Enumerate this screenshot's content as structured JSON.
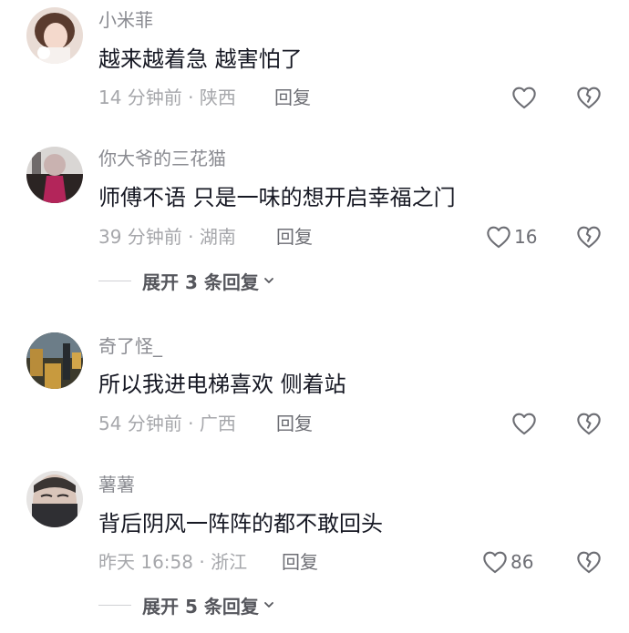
{
  "comments": [
    {
      "username": "小米菲",
      "text": "越来越着急 越害怕了",
      "meta": "14 分钟前 · 陕西",
      "reply": "回复",
      "likes": ""
    },
    {
      "username": "你大爷的三花猫",
      "text": "师傅不语 只是一味的想开启幸福之门",
      "meta": "39 分钟前 · 湖南",
      "reply": "回复",
      "likes": "16",
      "expand": "展开 3 条回复"
    },
    {
      "username": "奇了怪_",
      "text": "所以我进电梯喜欢 侧着站",
      "meta": "54 分钟前 · 广西",
      "reply": "回复",
      "likes": ""
    },
    {
      "username": "薯薯",
      "text": "背后阴风一阵阵的都不敢回头",
      "meta": "昨天 16:58 · 浙江",
      "reply": "回复",
      "likes": "86",
      "expand": "展开 5 条回复"
    }
  ],
  "icons": {
    "like": "heart-outline-icon",
    "dislike": "broken-heart-icon",
    "chevron": "chevron-down-icon"
  },
  "colors": {
    "username": "#8a8b91",
    "text": "#161823",
    "meta": "#a6a7ab",
    "icon": "#6d6e74"
  }
}
